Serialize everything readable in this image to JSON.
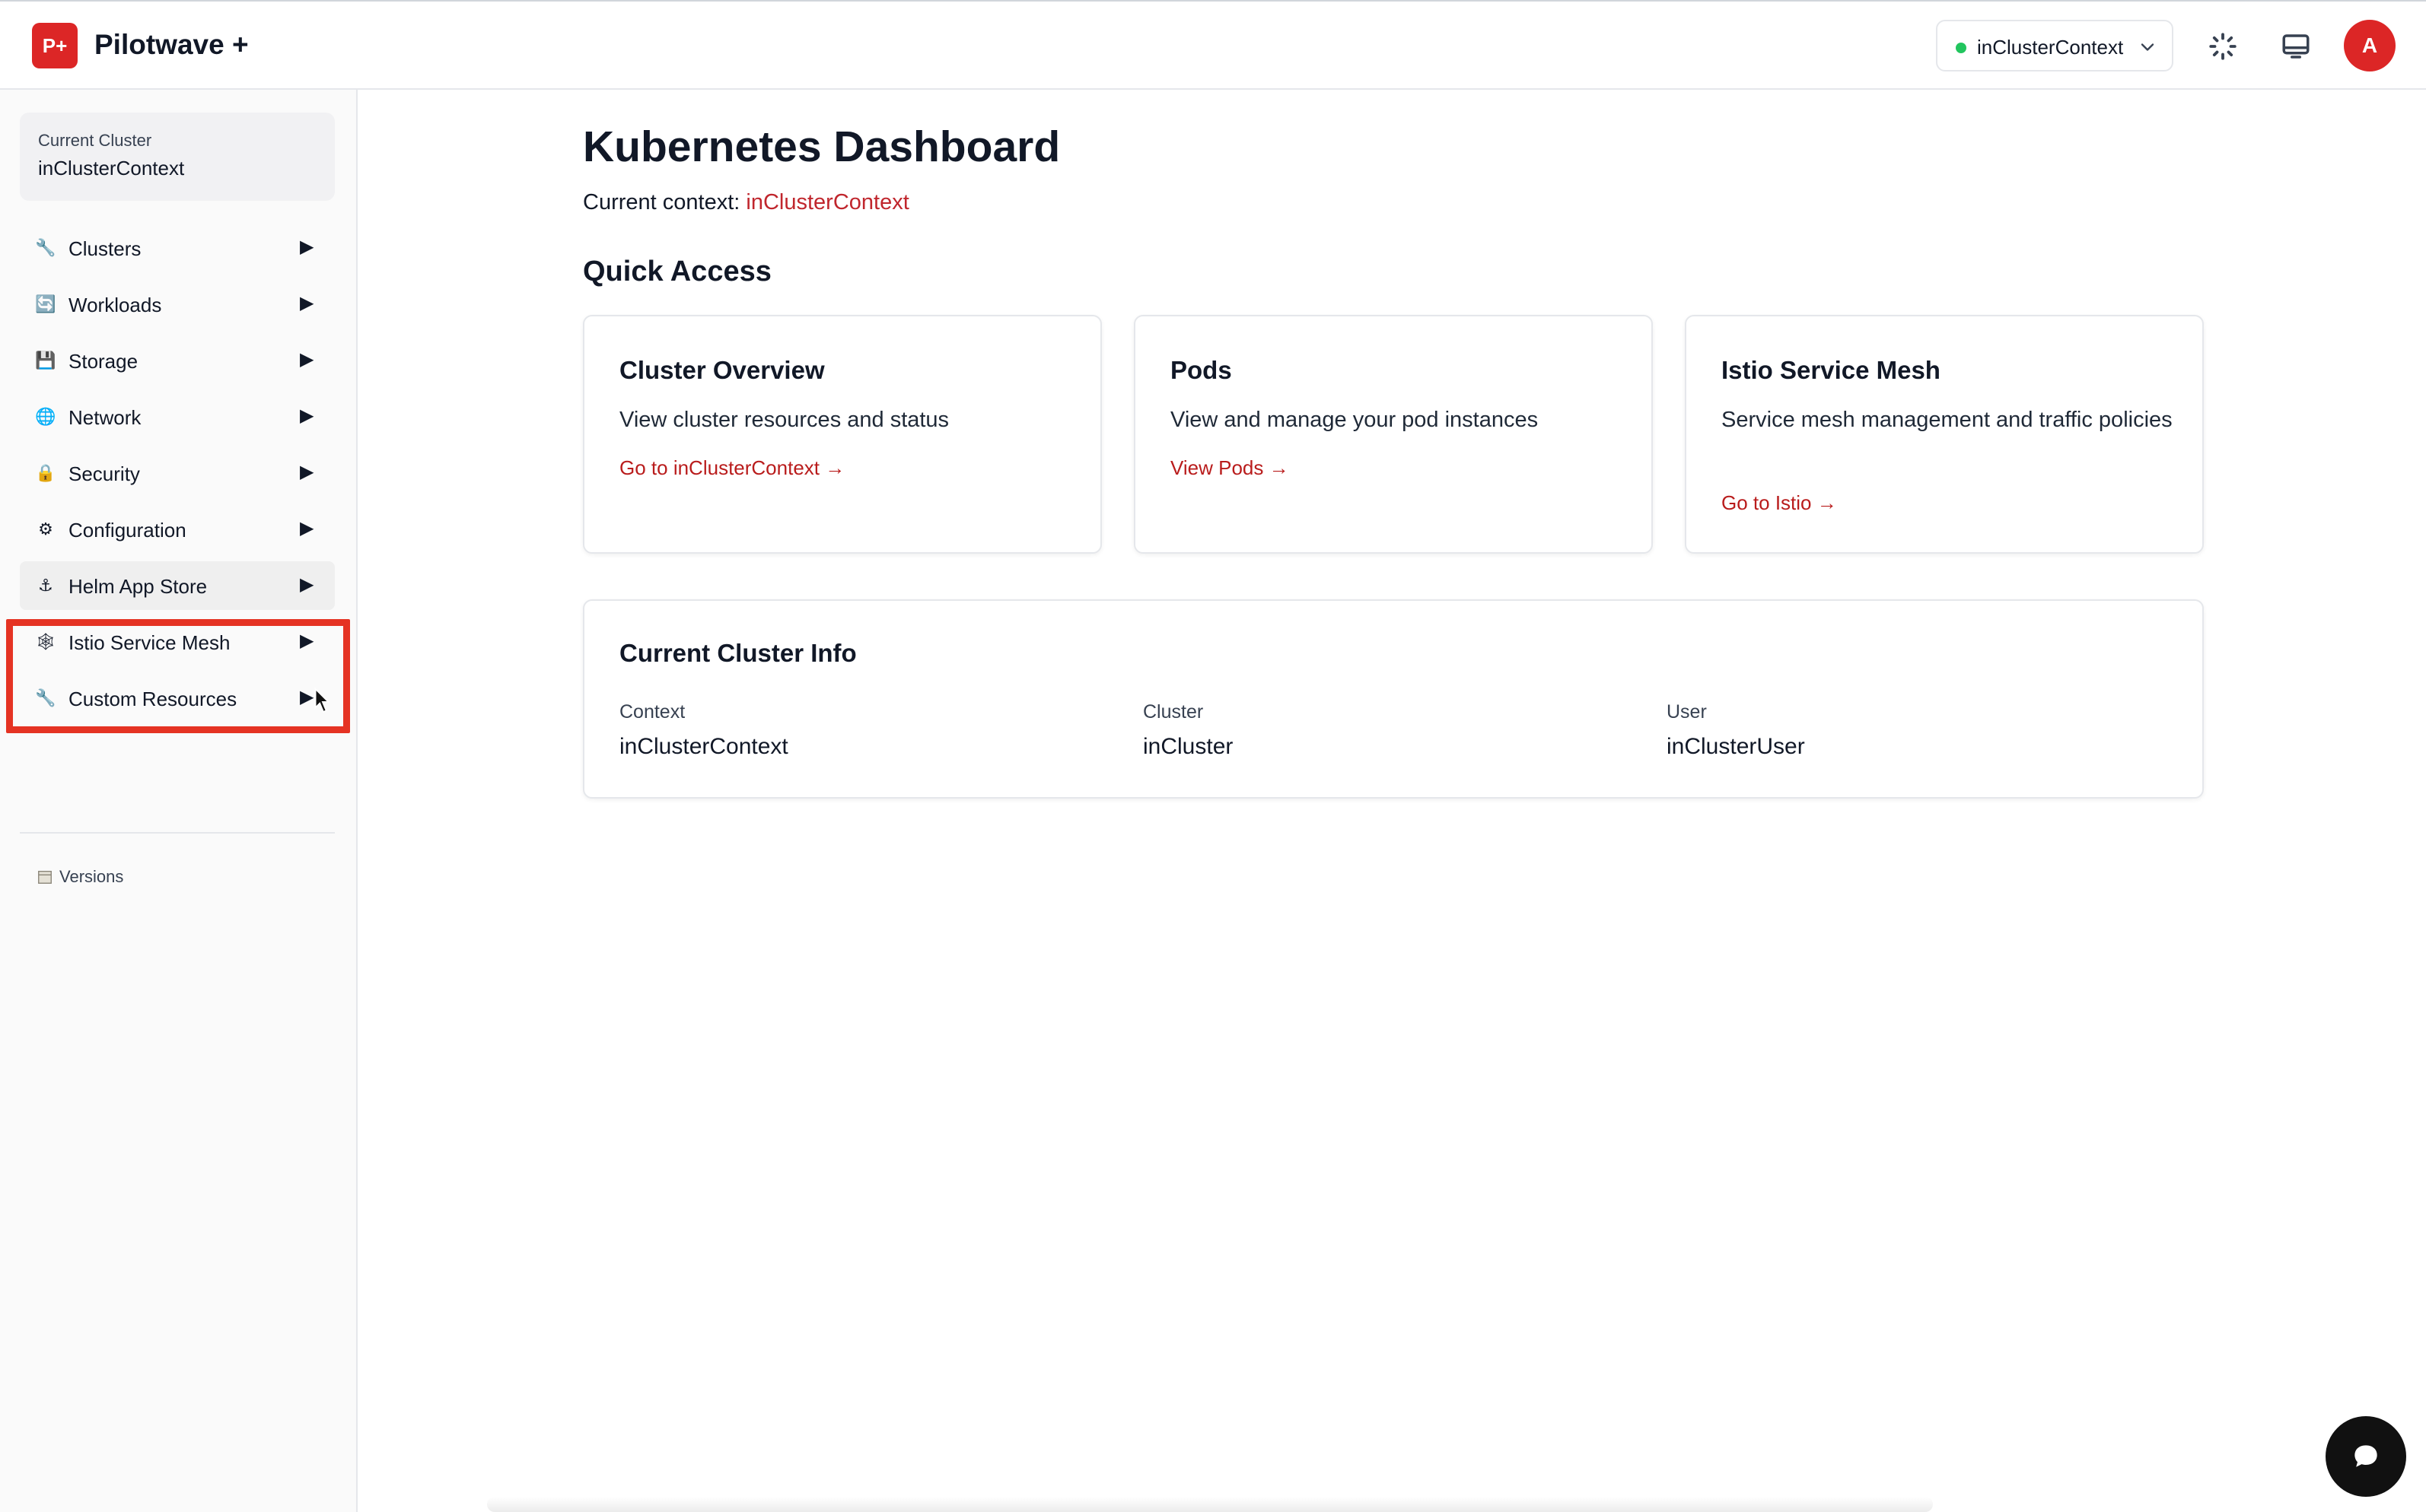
{
  "header": {
    "logo_text": "P+",
    "app_title": "Pilotwave +",
    "context_switcher": {
      "label": "inClusterContext",
      "status_color": "#22c55e"
    },
    "avatar_initial": "A",
    "icons": [
      "loading-spinner-icon",
      "monitor-icon",
      "chevron-down-icon"
    ],
    "accent_color": "#dc2626"
  },
  "sidebar": {
    "current_cluster_label": "Current Cluster",
    "current_cluster_value": "inClusterContext",
    "items": [
      {
        "label": "Clusters",
        "icon": "wrench-icon",
        "glyph": "🔧"
      },
      {
        "label": "Workloads",
        "icon": "refresh-icon",
        "glyph": "🔄"
      },
      {
        "label": "Storage",
        "icon": "storage-icon",
        "glyph": "💾"
      },
      {
        "label": "Network",
        "icon": "globe-icon",
        "glyph": "🌐"
      },
      {
        "label": "Security",
        "icon": "lock-icon",
        "glyph": "🔒"
      },
      {
        "label": "Configuration",
        "icon": "gear-icon",
        "glyph": "⚙"
      },
      {
        "label": "Helm App Store",
        "icon": "anchor-icon",
        "glyph": "⚓"
      },
      {
        "label": "Istio Service Mesh",
        "icon": "mesh-icon",
        "glyph": "🕸"
      },
      {
        "label": "Custom Resources",
        "icon": "wrench-icon",
        "glyph": "🔧"
      }
    ],
    "arrow_glyph": "▶",
    "versions_label": "Versions",
    "highlight_color": "#e53323"
  },
  "main": {
    "title": "Kubernetes Dashboard",
    "context_prefix": "Current context:",
    "context_value": "inClusterContext",
    "quick_access_title": "Quick Access",
    "cards": [
      {
        "title": "Cluster Overview",
        "description": "View cluster resources and status",
        "link": "Go to inClusterContext →"
      },
      {
        "title": "Pods",
        "description": "View and manage your pod instances",
        "link": "View Pods →"
      },
      {
        "title": "Istio Service Mesh",
        "description": "Service mesh management and traffic policies",
        "link": "Go to Istio →"
      }
    ],
    "cluster_info": {
      "title": "Current Cluster Info",
      "fields": [
        {
          "label": "Context",
          "value": "inClusterContext"
        },
        {
          "label": "Cluster",
          "value": "inCluster"
        },
        {
          "label": "User",
          "value": "inClusterUser"
        }
      ]
    },
    "link_color": "#b91c1c"
  }
}
